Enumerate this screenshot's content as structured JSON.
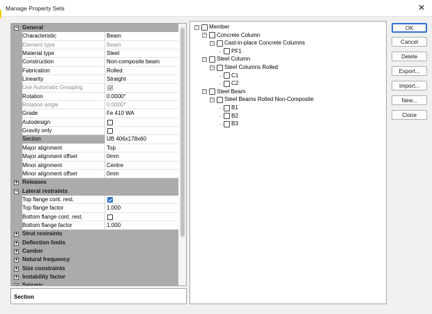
{
  "window": {
    "title": "Manage Property Sets",
    "close_glyph": "✕"
  },
  "property_grid": {
    "rows": [
      {
        "type": "category",
        "label": "General",
        "toggle": "−"
      },
      {
        "type": "prop",
        "label": "Characteristic",
        "value": "Beam"
      },
      {
        "type": "prop",
        "label": "Element type",
        "value": "Beam",
        "disabled": true
      },
      {
        "type": "prop",
        "label": "Material type",
        "value": "Steel"
      },
      {
        "type": "prop",
        "label": "Construction",
        "value": "Non-composite beam"
      },
      {
        "type": "prop",
        "label": "Fabrication",
        "value": "Rolled"
      },
      {
        "type": "prop",
        "label": "Linearity",
        "value": "Straight"
      },
      {
        "type": "prop",
        "label": "Use Automatic Grouping",
        "value": "",
        "checkbox": true,
        "checked": true,
        "disabled": true
      },
      {
        "type": "prop",
        "label": "Rotation",
        "value": "0.0000°"
      },
      {
        "type": "prop",
        "label": "Rotation angle",
        "value": "0.0000°",
        "disabled": true
      },
      {
        "type": "prop",
        "label": "Grade",
        "value": "Fe 410 WA"
      },
      {
        "type": "prop",
        "label": "Autodesign",
        "value": "",
        "checkbox": true,
        "checked": false
      },
      {
        "type": "prop",
        "label": "Gravity only",
        "value": "",
        "checkbox": true,
        "checked": false
      },
      {
        "type": "prop",
        "label": "Section",
        "value": "UB 406x178x60",
        "selected": true
      },
      {
        "type": "prop",
        "label": "Major alignment",
        "value": "Top"
      },
      {
        "type": "prop",
        "label": "Major alignment offset",
        "value": "0mm"
      },
      {
        "type": "prop",
        "label": "Minor alignment",
        "value": "Centre"
      },
      {
        "type": "prop",
        "label": "Minor alignment offset",
        "value": "0mm"
      },
      {
        "type": "category",
        "label": "Releases",
        "toggle": "+"
      },
      {
        "type": "category",
        "label": "Lateral restraints",
        "toggle": "−"
      },
      {
        "type": "prop",
        "label": "Top flange cont. rest.",
        "value": "",
        "checkbox": true,
        "checked": true
      },
      {
        "type": "prop",
        "label": "Top flange factor",
        "value": "1.000"
      },
      {
        "type": "prop",
        "label": "Bottom flange cont. rest.",
        "value": "",
        "checkbox": true,
        "checked": false
      },
      {
        "type": "prop",
        "label": "Bottom flange factor",
        "value": "1.000"
      },
      {
        "type": "category",
        "label": "Strut restraints",
        "toggle": "+"
      },
      {
        "type": "category",
        "label": "Deflection limits",
        "toggle": "+"
      },
      {
        "type": "category",
        "label": "Camber",
        "toggle": "+"
      },
      {
        "type": "category",
        "label": "Natural frequency",
        "toggle": "+"
      },
      {
        "type": "category",
        "label": "Size constraints",
        "toggle": "+"
      },
      {
        "type": "category",
        "label": "Instability factor",
        "toggle": "+"
      },
      {
        "type": "category",
        "label": "Seismic",
        "toggle": "−"
      }
    ]
  },
  "description": {
    "title": "Section"
  },
  "tree": {
    "nodes": [
      {
        "label": "Member",
        "level": 0,
        "expander": "−"
      },
      {
        "label": "Concrete Column",
        "level": 1,
        "expander": "−"
      },
      {
        "label": "Cast-in-place Concrete Columns",
        "level": 2,
        "expander": "−"
      },
      {
        "label": "PF1",
        "level": 3,
        "expander": ""
      },
      {
        "label": "Steel Column",
        "level": 1,
        "expander": "−"
      },
      {
        "label": "Steel Columns Rolled",
        "level": 2,
        "expander": "−"
      },
      {
        "label": "C1",
        "level": 3,
        "expander": ""
      },
      {
        "label": "C2",
        "level": 3,
        "expander": ""
      },
      {
        "label": "Steel Beam",
        "level": 1,
        "expander": "−"
      },
      {
        "label": "Steel Beams Rolled Non-Composite",
        "level": 2,
        "expander": "−"
      },
      {
        "label": "B1",
        "level": 3,
        "expander": ""
      },
      {
        "label": "B2",
        "level": 3,
        "expander": ""
      },
      {
        "label": "B3",
        "level": 3,
        "expander": ""
      }
    ]
  },
  "buttons": {
    "ok": "OK",
    "cancel": "Cancel",
    "delete": "Delete",
    "export": "Export...",
    "import": "Import...",
    "new": "New...",
    "clone": "Clone"
  },
  "colors": {
    "accent": "#2e6fd4",
    "category_bg": "#ababab"
  }
}
